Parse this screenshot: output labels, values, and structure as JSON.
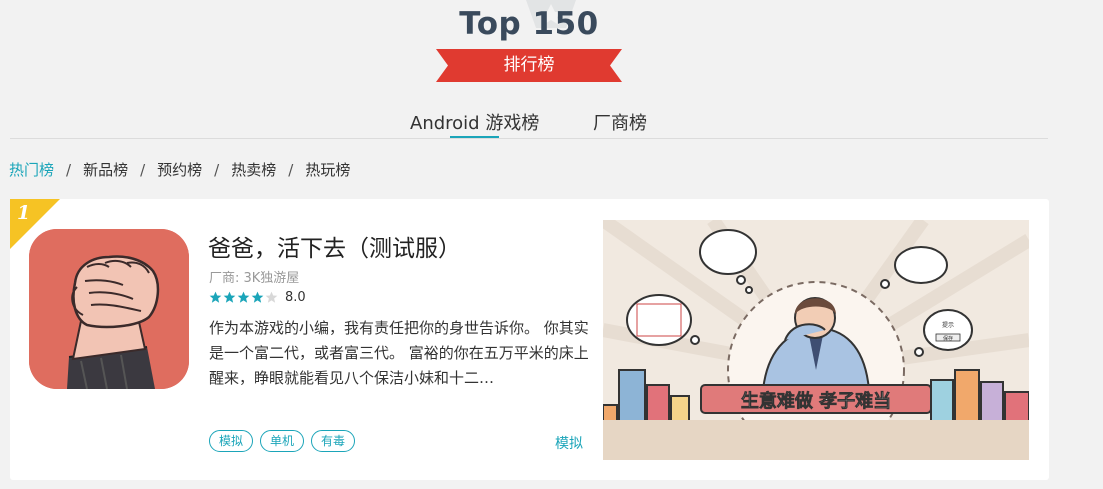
{
  "header": {
    "title": "Top 150",
    "ribbon_label": "排行榜"
  },
  "tabs": [
    {
      "label": "Android 游戏榜",
      "active": true
    },
    {
      "label": "厂商榜",
      "active": false
    }
  ],
  "subnav": [
    {
      "label": "热门榜",
      "active": true
    },
    {
      "label": "新品榜",
      "active": false
    },
    {
      "label": "预约榜",
      "active": false
    },
    {
      "label": "热卖榜",
      "active": false
    },
    {
      "label": "热玩榜",
      "active": false
    }
  ],
  "subnav_separator": "/",
  "games": [
    {
      "rank": "1",
      "title": "爸爸，活下去（测试服）",
      "vendor": "厂商: 3K独游屋",
      "stars_filled": 4,
      "stars_total": 5,
      "score": "8.0",
      "description": "作为本游戏的小编，我有责任把你的身世告诉你。 你其实是一个富二代，或者富三代。 富裕的你在五万平米的床上醒来，睁眼就能看见八个保洁小妹和十二…",
      "tags": [
        "模拟",
        "单机",
        "有毒"
      ],
      "category": "模拟",
      "screenshot_caption": "生意难做  孝子难当",
      "screenshot_small_text": [
        "提示",
        "保存"
      ]
    }
  ],
  "colors": {
    "accent": "#1ba5b9",
    "ribbon": "#e03a30",
    "badge": "#f6c324",
    "icon_bg": "#df6d5f",
    "title": "#3a4a5c"
  }
}
